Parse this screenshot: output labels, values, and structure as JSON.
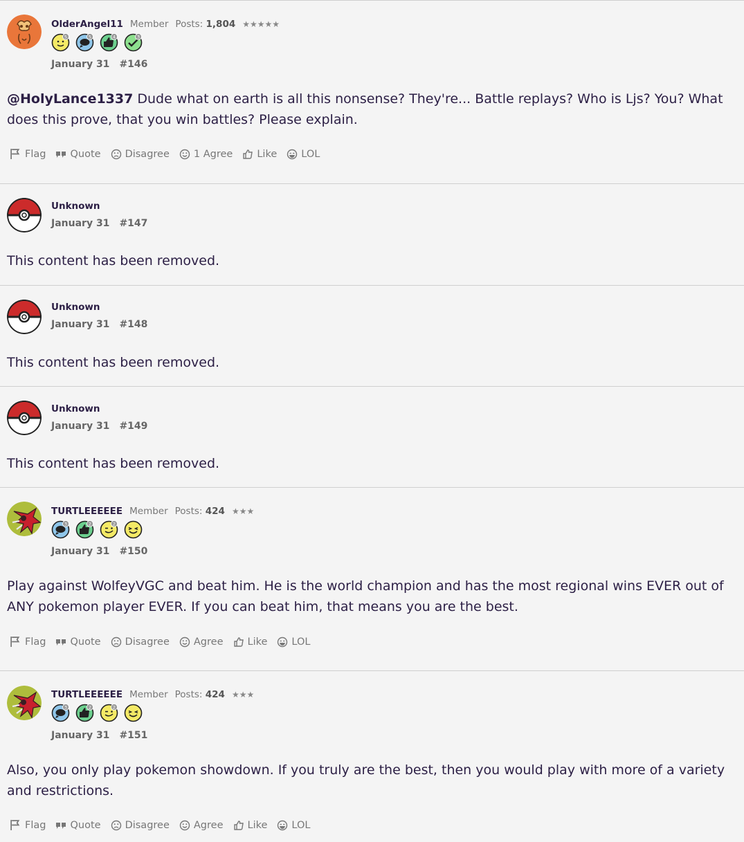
{
  "posts": [
    {
      "username": "OlderAngel11",
      "role": "Member",
      "posts_label": "Posts:",
      "posts_count": "1,804",
      "stars": "★★★★★",
      "date": "January 31",
      "number": "#146",
      "mention": "@HolyLance1337",
      "body": " Dude what on earth is all this nonsense? They're... Battle replays? Who is Ljs? You? What does this prove, that you win battles? Please explain.",
      "actions": [
        "Flag",
        "Quote",
        "Disagree",
        "1 Agree",
        "Like",
        "LOL"
      ],
      "badge_counts": [
        "5",
        "5",
        "4",
        "3"
      ]
    },
    {
      "username": "Unknown",
      "date": "January 31",
      "number": "#147",
      "body": "This content has been removed."
    },
    {
      "username": "Unknown",
      "date": "January 31",
      "number": "#148",
      "body": "This content has been removed."
    },
    {
      "username": "Unknown",
      "date": "January 31",
      "number": "#149",
      "body": "This content has been removed."
    },
    {
      "username": "TURTLEEEEEE",
      "role": "Member",
      "posts_label": "Posts:",
      "posts_count": "424",
      "stars": "★★★",
      "date": "January 31",
      "number": "#150",
      "body": "Play against WolfeyVGC and beat him. He is the world champion and has the most regional wins EVER out of ANY pokemon player EVER. If you can beat him, that means you are the best.",
      "actions": [
        "Flag",
        "Quote",
        "Disagree",
        "Agree",
        "Like",
        "LOL"
      ],
      "badge_counts": [
        "3",
        "2",
        "2"
      ]
    },
    {
      "username": "TURTLEEEEEE",
      "role": "Member",
      "posts_label": "Posts:",
      "posts_count": "424",
      "stars": "★★★",
      "date": "January 31",
      "number": "#151",
      "body": "Also, you only play pokemon showdown. If you truly are the best, then you would play with more of a variety and restrictions.",
      "actions": [
        "Flag",
        "Quote",
        "Disagree",
        "Agree",
        "Like",
        "LOL"
      ],
      "badge_counts": [
        "3",
        "2",
        "2"
      ]
    }
  ],
  "colors": {
    "background": "#f4f4f4",
    "text": "#2c1f45",
    "muted": "#777777",
    "divider": "#cfcfcf",
    "pokeball_red": "#cc2b2b"
  }
}
